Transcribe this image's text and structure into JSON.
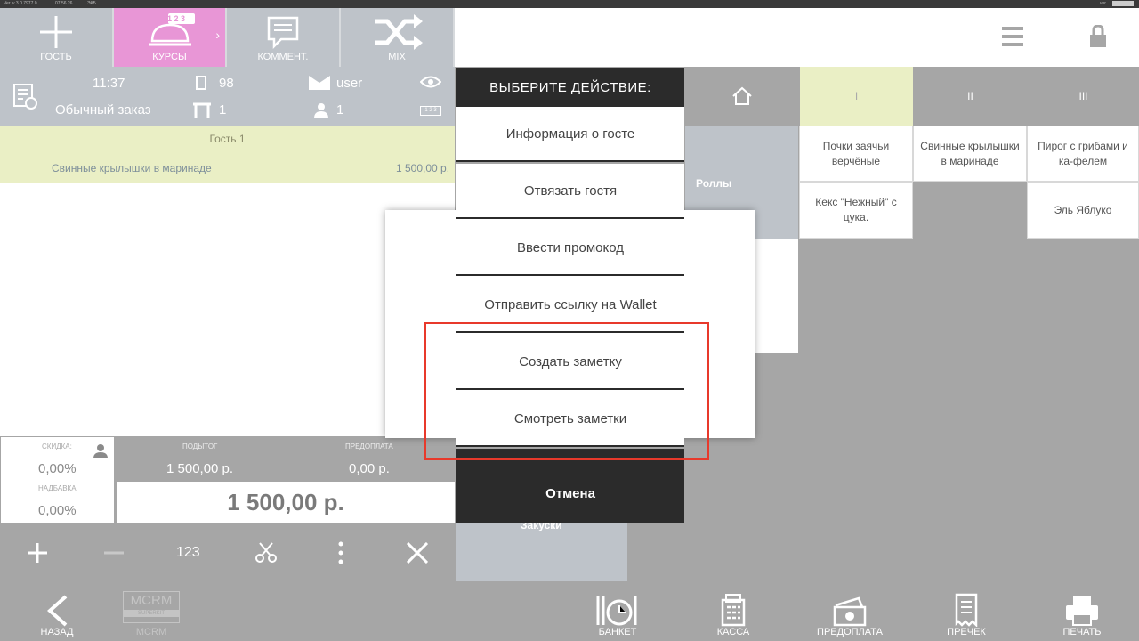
{
  "status_bar": {
    "left_a": "Ver. v 3.0.7977.0",
    "left_b": "07:56.26",
    "left_c": "ЭКБ",
    "right": "ver"
  },
  "top_buttons": {
    "guest": "ГОСТЬ",
    "courses": "КУРСЫ",
    "courses_badge": "1 2 3",
    "comment": "КОММЕНТ.",
    "mix": "MIX"
  },
  "order": {
    "time": "11:37",
    "type": "Обычный заказ",
    "number": "98",
    "table": "1",
    "user": "user",
    "guests": "1",
    "badge": "1 2 3"
  },
  "guest_row": "Гость 1",
  "item": {
    "name": "Свинные крылышки в маринаде",
    "price": "1 500,00 р."
  },
  "totals": {
    "discount_label": "СКИДКА:",
    "discount": "0,00%",
    "markup_label": "НАДБАВКА:",
    "markup": "0,00%",
    "subtotal_label": "ПОДЫТОГ",
    "subtotal": "1 500,00 р.",
    "prepay_label": "ПРЕДОПЛАТА",
    "prepay": "0,00 р.",
    "total": "1 500,00 р."
  },
  "toolbar2": {
    "num": "123"
  },
  "tabs": [
    "I",
    "II",
    "III"
  ],
  "categories": {
    "rolls": "Роллы",
    "snacks": "Закуски"
  },
  "menu_items": {
    "a": "Почки заячьи верчёные",
    "b": "Свинные крылышки в маринаде",
    "c": "Пирог с грибами и ка-фелем",
    "d": "Кекс \"Нежный\" с цука.",
    "e": "Эль Яблуко"
  },
  "dialog": {
    "title": "ВЫБЕРИТЕ ДЕЙСТВИЕ:",
    "items": [
      "Информация о госте",
      "Отвязать гостя",
      "Ввести промокод",
      "Отправить ссылку на Wallet",
      "Создать заметку",
      "Смотреть заметки"
    ],
    "cancel": "Отмена"
  },
  "bottom": {
    "back": "НАЗАД",
    "mcrm": "MCRM",
    "mcrm_logo": "MCRM",
    "mcrm_sub": "SUPERKIT",
    "banquet": "БАНКЕТ",
    "cashier": "КАССА",
    "prepay": "ПРЕДОПЛАТА",
    "precheck": "ПРЕЧЕК",
    "print": "ПЕЧАТЬ"
  },
  "colors": {
    "accent_pink": "#e896d6",
    "panel_grey": "#bec3c9",
    "highlight_yellow": "#eaefc5",
    "dialog_dark": "#2b2b2b",
    "annotation_red": "#e8392b"
  }
}
